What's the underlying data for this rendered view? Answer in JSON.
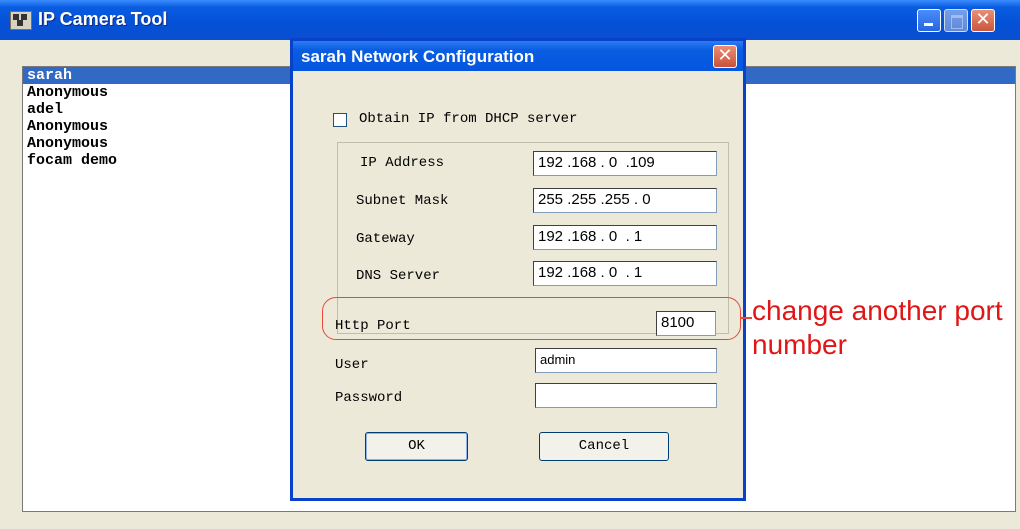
{
  "app": {
    "title": "IP Camera Tool"
  },
  "camera_list": [
    "sarah",
    "Anonymous",
    "adel",
    "Anonymous",
    "Anonymous",
    "focam demo"
  ],
  "dialog": {
    "title": "sarah Network Configuration",
    "dhcp_label": "Obtain IP from DHCP server",
    "dhcp_checked": false,
    "ip_address_label": "IP Address",
    "ip_address_value": "192 .168 . 0  .109",
    "subnet_mask_label": "Subnet Mask",
    "subnet_mask_value": "255 .255 .255 . 0",
    "gateway_label": "Gateway",
    "gateway_value": "192 .168 . 0  . 1",
    "dns_label": "DNS Server",
    "dns_value": "192 .168 . 0  . 1",
    "http_port_label": "Http Port",
    "http_port_value": "8100",
    "user_label": "User",
    "user_value": "admin",
    "password_label": "Password",
    "password_value": "",
    "ok_label": "OK",
    "cancel_label": "Cancel"
  },
  "annotation": {
    "text": "change another port number",
    "color": "#e01616"
  },
  "colors": {
    "titlebar": "#0a5de0",
    "selection": "#316ac5",
    "window_bg": "#ece9d8"
  }
}
